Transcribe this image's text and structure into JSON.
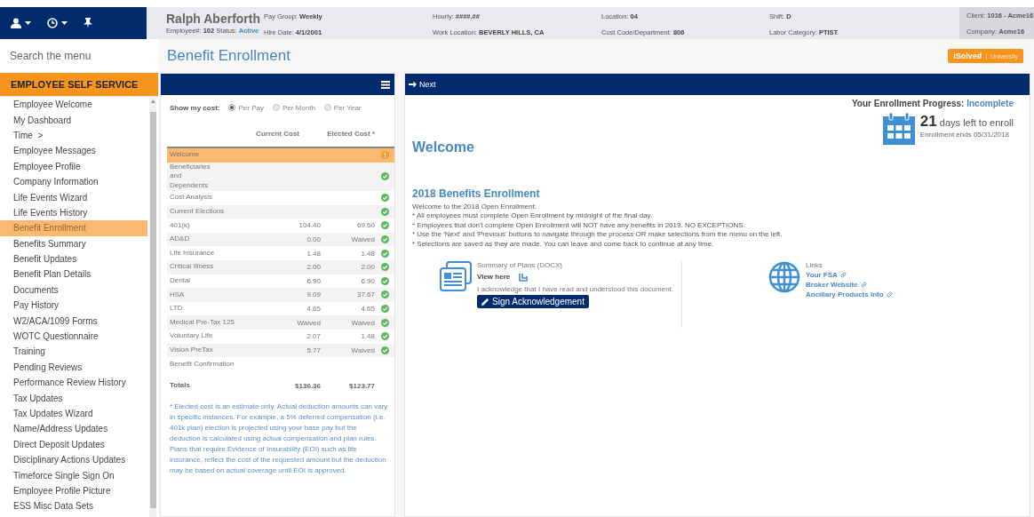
{
  "employee": {
    "name": "Ralph Aberforth",
    "id_label": "Employee#:",
    "id": "102",
    "status_label": "Status:",
    "status": "Active"
  },
  "info_columns": [
    [
      {
        "label": "Pay Group:",
        "value": "Weekly"
      },
      {
        "label": "Hire Date:",
        "value": "4/1/2001"
      }
    ],
    [
      {
        "label": "Hourly:",
        "value": "####.##"
      },
      {
        "label": "Work Location:",
        "value": "BEVERLY HILLS, CA"
      }
    ],
    [
      {
        "label": "Location:",
        "value": "04"
      },
      {
        "label": "Cost Code/Department:",
        "value": "806"
      }
    ],
    [
      {
        "label": "Shift:",
        "value": "D"
      },
      {
        "label": "Labor Category:",
        "value": "PTIST"
      }
    ]
  ],
  "client": [
    {
      "label": "Client:",
      "value": "1016 - Acme16"
    },
    {
      "label": "Company:",
      "value": "Acme16"
    }
  ],
  "search": {
    "placeholder": "Search the menu"
  },
  "sidebar": {
    "section": "EMPLOYEE SELF SERVICE",
    "items": [
      {
        "label": "Employee Welcome",
        "selected": false
      },
      {
        "label": "My Dashboard",
        "selected": false
      },
      {
        "label": "Time",
        "suffix": ">",
        "selected": false
      },
      {
        "label": "Employee Messages",
        "selected": false
      },
      {
        "label": "Employee Profile",
        "selected": false
      },
      {
        "label": "Company Information",
        "selected": false
      },
      {
        "label": "Life Events Wizard",
        "selected": false
      },
      {
        "label": "Life Events History",
        "selected": false
      },
      {
        "label": "Benefit Enrollment",
        "selected": true
      },
      {
        "label": "Benefits Summary",
        "selected": false
      },
      {
        "label": "Benefit Updates",
        "selected": false
      },
      {
        "label": "Benefit Plan Details",
        "selected": false
      },
      {
        "label": "Documents",
        "selected": false
      },
      {
        "label": "Pay History",
        "selected": false
      },
      {
        "label": "W2/ACA/1099 Forms",
        "selected": false
      },
      {
        "label": "WOTC Questionnaire",
        "selected": false
      },
      {
        "label": "Training",
        "selected": false
      },
      {
        "label": "Pending Reviews",
        "selected": false
      },
      {
        "label": "Performance Review History",
        "selected": false
      },
      {
        "label": "Tax Updates",
        "selected": false
      },
      {
        "label": "Tax Updates Wizard",
        "selected": false
      },
      {
        "label": "Name/Address Updates",
        "selected": false
      },
      {
        "label": "Direct Deposit Updates",
        "selected": false
      },
      {
        "label": "Disciplinary Actions Updates",
        "selected": false
      },
      {
        "label": "Timeforce Single Sign On",
        "selected": false
      },
      {
        "label": "Employee Profile Picture",
        "selected": false
      },
      {
        "label": "ESS Misc Data Sets",
        "selected": false
      }
    ]
  },
  "page_title": "Benefit Enrollment",
  "brand_button": {
    "label": "iSolved",
    "sub": "University"
  },
  "cost_panel": {
    "show_label": "Show my cost:",
    "periods": [
      {
        "label": "Per Pay",
        "selected": true
      },
      {
        "label": "Per Month",
        "selected": false
      },
      {
        "label": "Per Year",
        "selected": false
      }
    ],
    "columns": [
      "Current Cost",
      "Elected Cost *"
    ],
    "steps": [
      {
        "label": "Welcome",
        "complete": false,
        "flagged": true,
        "selected": true
      },
      {
        "label": "Beneficiaries and Dependents",
        "complete": true,
        "flagged": false,
        "selected": false
      },
      {
        "label": "Cost Analysis",
        "complete": true,
        "flagged": false,
        "selected": false
      },
      {
        "label": "Current Elections",
        "complete": true,
        "flagged": false,
        "selected": false
      },
      {
        "label": "401(k)",
        "current": "104.40",
        "elected": "69.60",
        "complete": true,
        "flagged": false,
        "selected": false
      },
      {
        "label": "AD&D",
        "current": "0.00",
        "elected": "Waived",
        "complete": true,
        "flagged": false,
        "selected": false
      },
      {
        "label": "Life Insurance",
        "current": "1.48",
        "elected": "1.48",
        "complete": true,
        "flagged": false,
        "selected": false
      },
      {
        "label": "Critical Illness",
        "current": "2.00",
        "elected": "2.00",
        "complete": true,
        "flagged": false,
        "selected": false
      },
      {
        "label": "Dental",
        "current": "6.90",
        "elected": "6.90",
        "complete": true,
        "flagged": false,
        "selected": false
      },
      {
        "label": "HSA",
        "current": "9.09",
        "elected": "37.67",
        "complete": true,
        "flagged": false,
        "selected": false
      },
      {
        "label": "LTD",
        "current": "4.65",
        "elected": "4.65",
        "complete": true,
        "flagged": false,
        "selected": false
      },
      {
        "label": "Medical Pre-Tax 125",
        "current": "Waived",
        "elected": "Waived",
        "complete": true,
        "flagged": false,
        "selected": false
      },
      {
        "label": "Voluntary Life",
        "current": "2.07",
        "elected": "1.48",
        "complete": true,
        "flagged": false,
        "selected": false
      },
      {
        "label": "Vision PreTax",
        "current": "5.77",
        "elected": "Waived",
        "complete": true,
        "flagged": false,
        "selected": false
      },
      {
        "label": "Benefit Confirmation",
        "complete": false,
        "flagged": false,
        "selected": false
      }
    ],
    "totals": {
      "label": "Totals",
      "current": "$136.36",
      "elected": "$123.77"
    },
    "note": "* Elected cost is an estimate only. Actual deduction amounts can vary in specific instances. For example, a 5% deferred compensation (i.e. 401k plan) election is projected using your base pay but the deduction is calculated using actual compensation and plan rules. Plans that require Evidence of Insurability (EOI) such as life insurance, reflect the cost of the requested amount but the deduction may be based on actual coverage until EOI is approved."
  },
  "wizard": {
    "next": "Next",
    "progress_label": "Your Enrollment Progress:",
    "progress": "Incomplete",
    "progress_complete": false,
    "days": "21",
    "days_text": "days left to enroll",
    "ends": "Enrollment ends 05/31/2018",
    "heading": "Welcome",
    "section_title": "2018 Benefits Enrollment",
    "lines": [
      "Welcome to the 2018 Open Enrollment:",
      "* All employees must complete Open Enrollment by midnight of the final day.",
      "* Employees that don't complete Open Enrollment will NOT have any benefits in 2019. NO EXCEPTIONS.",
      "* Use the 'Next' and 'Previous' buttons to navigate through the process OR make selections from the menu on the left.",
      "* Selections are saved as they are made. You can leave and come back to continue at any time."
    ],
    "document": {
      "title": "Summary of Plans (DOCX)",
      "view": "View here",
      "ack": "I acknowledge that I have read and understood this document.",
      "sign": "Sign Acknowledgement"
    },
    "links": {
      "title": "Links",
      "items": [
        "Your FSA",
        "Broker Website",
        "Ancillary Products Info"
      ]
    }
  }
}
